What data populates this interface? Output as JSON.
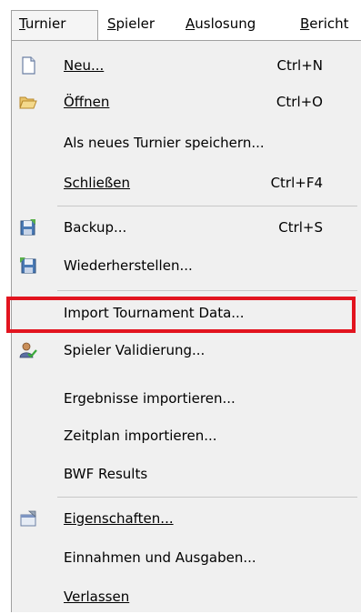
{
  "menubar": {
    "items": [
      {
        "label": "Turnier",
        "mnemonic": "T",
        "rest": "urnier"
      },
      {
        "label": "Spieler",
        "mnemonic": "S",
        "rest": "pieler"
      },
      {
        "label": "Auslosung",
        "mnemonic": "A",
        "rest": "uslosung"
      },
      {
        "label": "Bericht",
        "mnemonic": "B",
        "rest": "ericht"
      }
    ]
  },
  "menu": {
    "items": [
      {
        "label": "Neu...",
        "shortcut": "Ctrl+N",
        "icon": "new-document-icon"
      },
      {
        "label": "Öffnen",
        "shortcut": "Ctrl+O",
        "icon": "open-folder-icon"
      },
      {
        "label": "Als neues Turnier speichern...",
        "shortcut": ""
      },
      {
        "label": "Schließen",
        "shortcut": "Ctrl+F4"
      },
      {
        "label": "Backup...",
        "shortcut": "Ctrl+S",
        "icon": "backup-icon"
      },
      {
        "label": "Wiederherstellen...",
        "shortcut": "",
        "icon": "restore-icon"
      },
      {
        "label": "Import Tournament Data...",
        "shortcut": ""
      },
      {
        "label": "Spieler Validierung...",
        "shortcut": "",
        "icon": "player-validation-icon"
      },
      {
        "label": "Ergebnisse importieren...",
        "shortcut": ""
      },
      {
        "label": "Zeitplan importieren...",
        "shortcut": ""
      },
      {
        "label": "BWF Results",
        "shortcut": ""
      },
      {
        "label": "Eigenschaften...",
        "shortcut": "",
        "icon": "properties-icon"
      },
      {
        "label": "Einnahmen und Ausgaben...",
        "shortcut": ""
      },
      {
        "label": "Verlassen",
        "shortcut": ""
      }
    ]
  },
  "colors": {
    "highlight": "#e2141f",
    "menu_bg": "#f0f0f0"
  }
}
